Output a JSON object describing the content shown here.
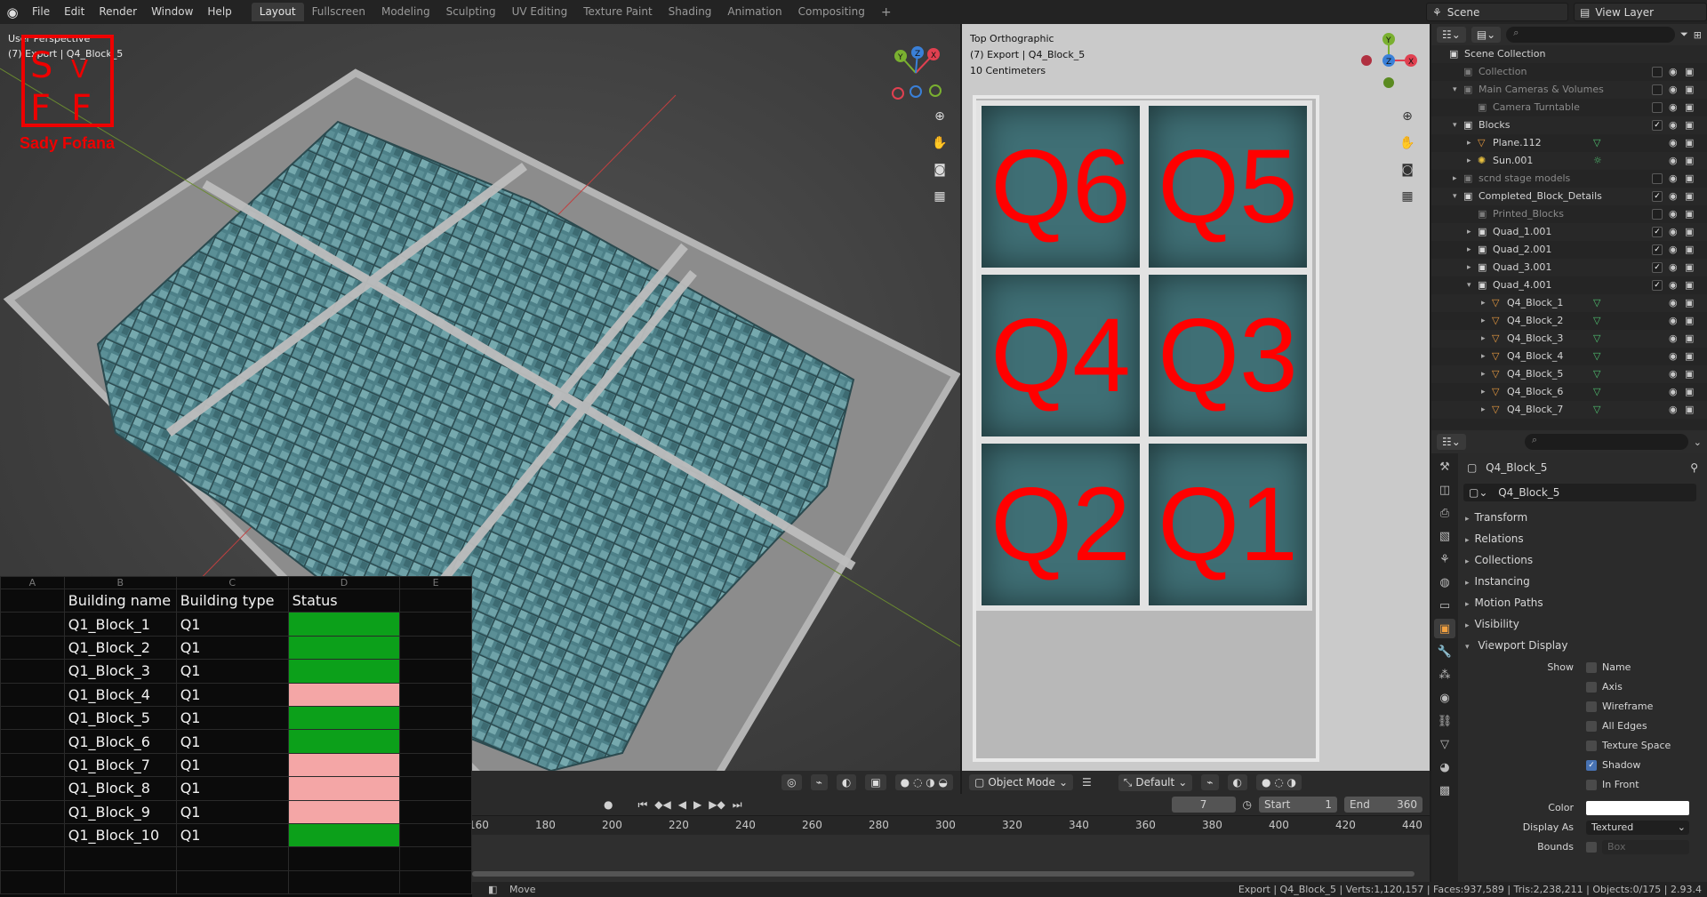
{
  "topbar": {
    "menus": [
      "File",
      "Edit",
      "Render",
      "Window",
      "Help"
    ],
    "workspaces": [
      "Layout",
      "Fullscreen",
      "Modeling",
      "Sculpting",
      "UV Editing",
      "Texture Paint",
      "Shading",
      "Animation",
      "Compositing"
    ],
    "active_workspace": "Layout",
    "scene": "Scene",
    "view_layer": "View Layer"
  },
  "viewport_left": {
    "info_line1": "User Perspective",
    "info_line2": "(7) Export | Q4_Block_5",
    "watermark": "Sady Fofana",
    "footer_mode": "",
    "colors": {
      "buildings": "#4d8088",
      "grid_lines": "#b0b0b0"
    }
  },
  "viewport_right": {
    "info_line1": "Top Orthographic",
    "info_line2": "(7) Export | Q4_Block_5",
    "info_line3": "10 Centimeters",
    "quad_labels": [
      "Q6",
      "Q5",
      "Q4",
      "Q3",
      "Q2",
      "Q1"
    ],
    "footer_mode": "Object Mode",
    "footer_orientation": "Default",
    "label_color": "#ff0000"
  },
  "spreadsheet": {
    "col_letters": [
      "A",
      "B",
      "C",
      "D",
      "E"
    ],
    "headers": [
      "Building name",
      "Building type",
      "Status"
    ],
    "rows": [
      {
        "name": "Q1_Block_1",
        "type": "Q1",
        "status": "green"
      },
      {
        "name": "Q1_Block_2",
        "type": "Q1",
        "status": "green"
      },
      {
        "name": "Q1_Block_3",
        "type": "Q1",
        "status": "green"
      },
      {
        "name": "Q1_Block_4",
        "type": "Q1",
        "status": "pink"
      },
      {
        "name": "Q1_Block_5",
        "type": "Q1",
        "status": "green"
      },
      {
        "name": "Q1_Block_6",
        "type": "Q1",
        "status": "green"
      },
      {
        "name": "Q1_Block_7",
        "type": "Q1",
        "status": "pink"
      },
      {
        "name": "Q1_Block_8",
        "type": "Q1",
        "status": "pink"
      },
      {
        "name": "Q1_Block_9",
        "type": "Q1",
        "status": "pink"
      },
      {
        "name": "Q1_Block_10",
        "type": "Q1",
        "status": "green"
      }
    ],
    "status_colors": {
      "green": "#0ca01a",
      "pink": "#f4a6a6"
    }
  },
  "outliner": {
    "rows": [
      {
        "label": "Scene Collection",
        "depth": 0,
        "icon": "collection",
        "arrow": "",
        "checked": null,
        "dim": false
      },
      {
        "label": "Collection",
        "depth": 1,
        "icon": "collection",
        "arrow": "",
        "checked": false,
        "dim": true
      },
      {
        "label": "Main Cameras & Volumes",
        "depth": 1,
        "icon": "collection",
        "arrow": "▾",
        "checked": false,
        "dim": true
      },
      {
        "label": "Camera Turntable",
        "depth": 2,
        "icon": "collection",
        "arrow": "",
        "checked": false,
        "dim": true
      },
      {
        "label": "Blocks",
        "depth": 1,
        "icon": "collection",
        "arrow": "▾",
        "checked": true,
        "dim": false
      },
      {
        "label": "Plane.112",
        "depth": 2,
        "icon": "mesh",
        "arrow": "▸",
        "checked": null,
        "dim": false
      },
      {
        "label": "Sun.001",
        "depth": 2,
        "icon": "light",
        "arrow": "▸",
        "checked": null,
        "dim": false
      },
      {
        "label": "scnd stage models",
        "depth": 1,
        "icon": "collection",
        "arrow": "▸",
        "checked": false,
        "dim": true
      },
      {
        "label": "Completed_Block_Details",
        "depth": 1,
        "icon": "collection",
        "arrow": "▾",
        "checked": true,
        "dim": false
      },
      {
        "label": "Printed_Blocks",
        "depth": 2,
        "icon": "collection",
        "arrow": "",
        "checked": false,
        "dim": true
      },
      {
        "label": "Quad_1.001",
        "depth": 2,
        "icon": "collection",
        "arrow": "▸",
        "checked": true,
        "dim": false
      },
      {
        "label": "Quad_2.001",
        "depth": 2,
        "icon": "collection",
        "arrow": "▸",
        "checked": true,
        "dim": false
      },
      {
        "label": "Quad_3.001",
        "depth": 2,
        "icon": "collection",
        "arrow": "▸",
        "checked": true,
        "dim": false
      },
      {
        "label": "Quad_4.001",
        "depth": 2,
        "icon": "collection",
        "arrow": "▾",
        "checked": true,
        "dim": false
      },
      {
        "label": "Q4_Block_1",
        "depth": 3,
        "icon": "mesh",
        "arrow": "▸",
        "checked": null,
        "dim": false
      },
      {
        "label": "Q4_Block_2",
        "depth": 3,
        "icon": "mesh",
        "arrow": "▸",
        "checked": null,
        "dim": false
      },
      {
        "label": "Q4_Block_3",
        "depth": 3,
        "icon": "mesh",
        "arrow": "▸",
        "checked": null,
        "dim": false
      },
      {
        "label": "Q4_Block_4",
        "depth": 3,
        "icon": "mesh",
        "arrow": "▸",
        "checked": null,
        "dim": false
      },
      {
        "label": "Q4_Block_5",
        "depth": 3,
        "icon": "mesh",
        "arrow": "▸",
        "checked": null,
        "dim": false
      },
      {
        "label": "Q4_Block_6",
        "depth": 3,
        "icon": "mesh",
        "arrow": "▸",
        "checked": null,
        "dim": false
      },
      {
        "label": "Q4_Block_7",
        "depth": 3,
        "icon": "mesh",
        "arrow": "▸",
        "checked": null,
        "dim": false
      }
    ]
  },
  "properties": {
    "object_name": "Q4_Block_5",
    "datablock_name": "Q4_Block_5",
    "sections": [
      "Transform",
      "Relations",
      "Collections",
      "Instancing",
      "Motion Paths",
      "Visibility"
    ],
    "open_section": "Viewport Display",
    "show_label": "Show",
    "show_options": [
      {
        "label": "Name",
        "checked": false
      },
      {
        "label": "Axis",
        "checked": false
      },
      {
        "label": "Wireframe",
        "checked": false
      },
      {
        "label": "All Edges",
        "checked": false
      },
      {
        "label": "Texture Space",
        "checked": false
      },
      {
        "label": "Shadow",
        "checked": true
      },
      {
        "label": "In Front",
        "checked": false
      }
    ],
    "color_label": "Color",
    "display_as_label": "Display As",
    "display_as_value": "Textured",
    "bounds_label": "Bounds",
    "bounds_value": "Box"
  },
  "timeline": {
    "current_frame": "7",
    "start_label": "Start",
    "start_value": "1",
    "end_label": "End",
    "end_value": "360",
    "ruler": [
      "160",
      "180",
      "200",
      "220",
      "240",
      "260",
      "280",
      "300",
      "320",
      "340",
      "360",
      "380",
      "400",
      "420",
      "440"
    ]
  },
  "statusbar": {
    "left": "Move",
    "right": "Export | Q4_Block_5 | Verts:1,120,157 | Faces:937,589 | Tris:2,238,211 | Objects:0/175 | 2.93.4"
  }
}
